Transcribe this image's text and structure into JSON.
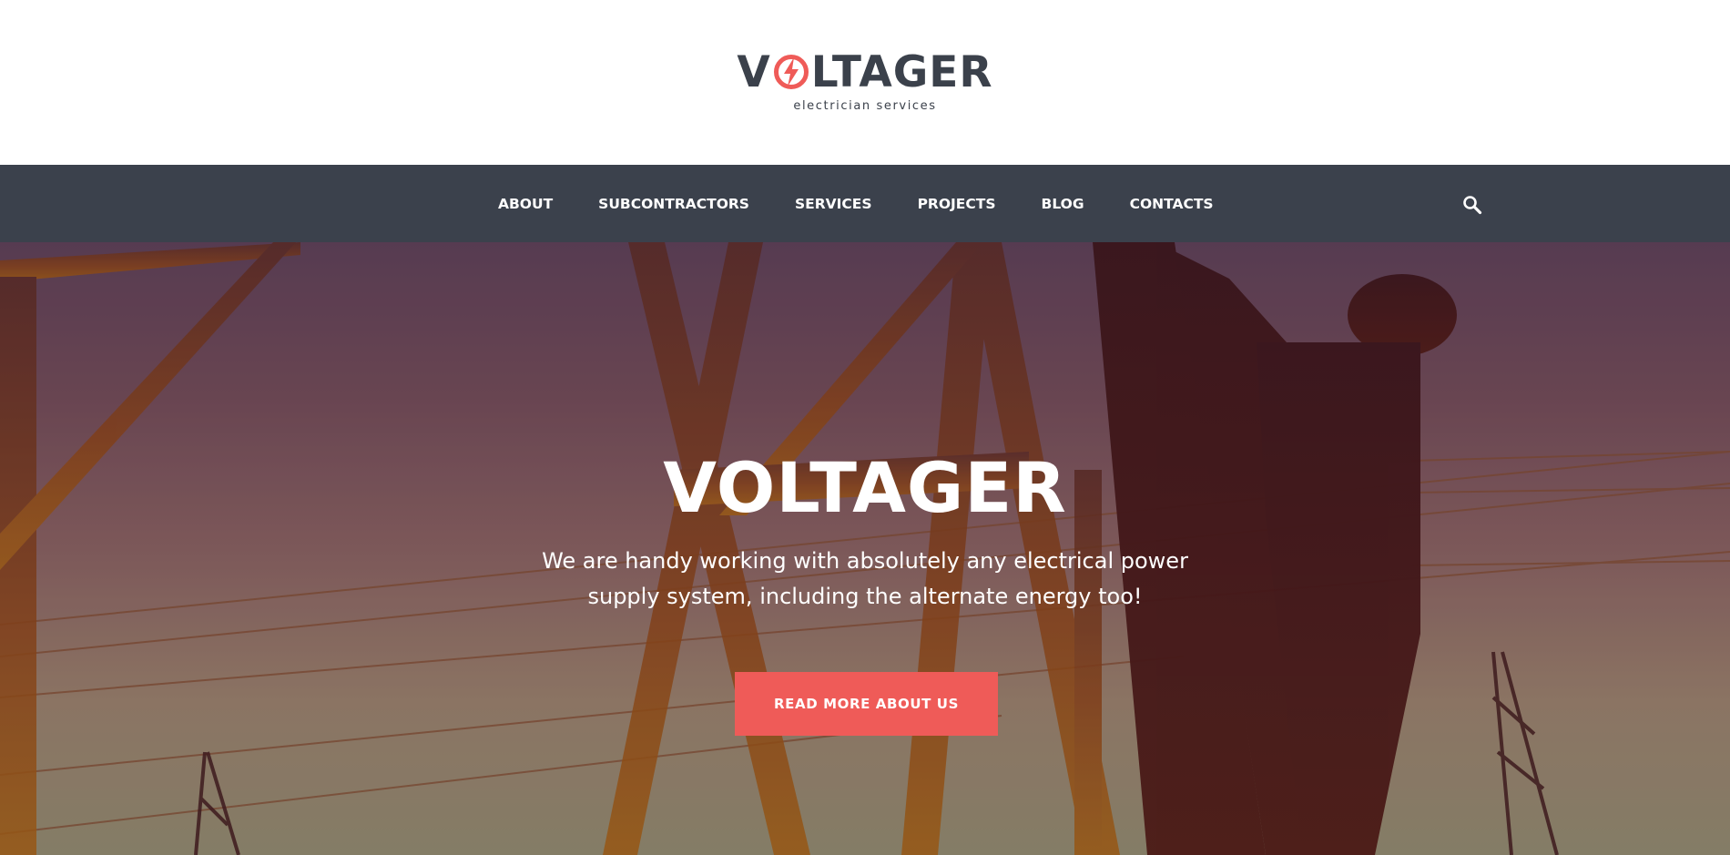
{
  "logo": {
    "part_v": "V",
    "part_rest": "LTAGER",
    "icon": "lightning-bolt-icon",
    "tagline": "electrician services"
  },
  "nav": {
    "items": [
      {
        "label": "ABOUT"
      },
      {
        "label": "SUBCONTRACTORS"
      },
      {
        "label": "SERVICES"
      },
      {
        "label": "PROJECTS"
      },
      {
        "label": "BLOG"
      },
      {
        "label": "CONTACTS"
      }
    ],
    "search_icon": "search-icon"
  },
  "hero": {
    "title": "VOLTAGER",
    "subtitle": "We are handy working with absolutely any electrical power supply system, including the alternate energy too!",
    "cta_label": "READ MORE ABOUT US"
  },
  "colors": {
    "brand_dark": "#3b414c",
    "accent": "#ef5b58",
    "white": "#ffffff"
  }
}
